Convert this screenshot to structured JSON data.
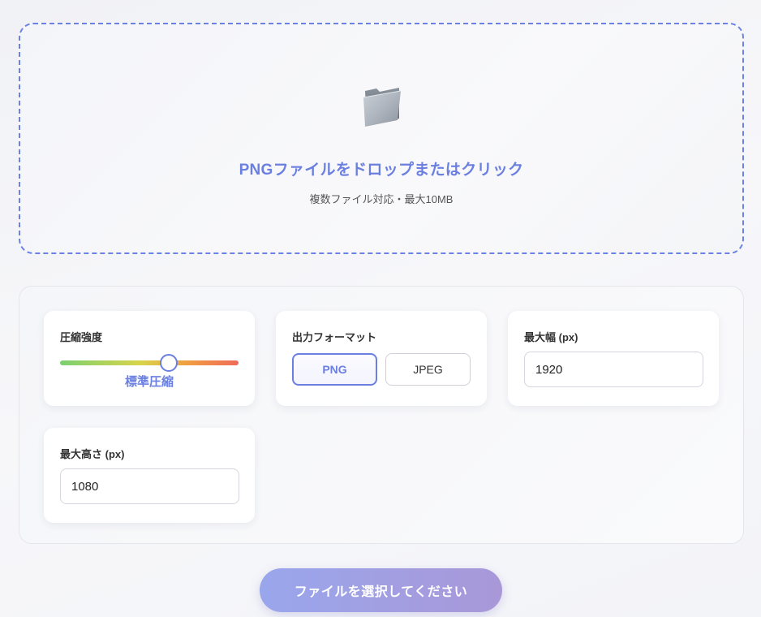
{
  "dropzone": {
    "icon": "folder-icon",
    "title": "PNGファイルをドロップまたはクリック",
    "subtitle": "複数ファイル対応・最大10MB"
  },
  "settings": {
    "compression": {
      "label": "圧縮強度",
      "level_fraction": 0.61,
      "value_label": "標準圧縮"
    },
    "format": {
      "label": "出力フォーマット",
      "options": [
        "PNG",
        "JPEG"
      ],
      "selected": "PNG"
    },
    "max_width": {
      "label": "最大幅 (px)",
      "value": "1920"
    },
    "max_height": {
      "label": "最大高さ (px)",
      "value": "1080"
    }
  },
  "submit": {
    "label": "ファイルを選択してください"
  },
  "colors": {
    "accent": "#6a7fe0",
    "slider_gradient": [
      "#7bd070",
      "#d8d44a",
      "#f0a040",
      "#f06a5a"
    ],
    "button_gradient": [
      "#9aa6ec",
      "#a898d8"
    ]
  }
}
